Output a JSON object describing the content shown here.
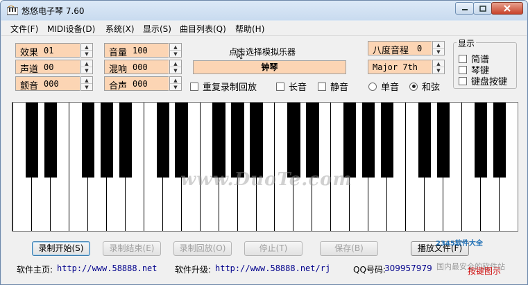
{
  "window": {
    "title": "悠悠电子琴 7.60"
  },
  "menu": [
    "文件(F)",
    "MIDI设备(D)",
    "系统(X)",
    "显示(S)",
    "曲目列表(Q)",
    "帮助(H)"
  ],
  "controls": {
    "effect": {
      "label": "效果",
      "value": "01"
    },
    "channel": {
      "label": "声道",
      "value": "00"
    },
    "tremolo": {
      "label": "颤音",
      "value": "000"
    },
    "volume": {
      "label": "音量",
      "value": "100"
    },
    "reverb": {
      "label": "混响",
      "value": "000"
    },
    "chorus": {
      "label": "合声",
      "value": "000"
    },
    "octave": {
      "label": "八度音程",
      "value": "0"
    },
    "chord_type": {
      "value": "Major 7th"
    }
  },
  "instrument": {
    "caption": "点击选择模拟乐器",
    "name": "钟琴"
  },
  "options": {
    "repeat_playback": {
      "label": "重复录制回放",
      "checked": false
    },
    "sustain": {
      "label": "长音",
      "checked": false
    },
    "mute": {
      "label": "静音",
      "checked": false
    },
    "single_note": {
      "label": "单音",
      "selected": false
    },
    "chord": {
      "label": "和弦",
      "selected": true
    }
  },
  "display_group": {
    "title": "显示",
    "items": [
      {
        "label": "简谱",
        "checked": false
      },
      {
        "label": "琴键",
        "checked": false
      },
      {
        "label": "键盘按键",
        "checked": false
      }
    ]
  },
  "piano": {
    "white_keys": 27,
    "black_key_pattern": [
      1,
      1,
      0,
      1,
      1,
      1,
      0,
      1,
      1,
      0,
      1,
      1,
      1,
      0,
      1,
      1,
      0,
      1,
      1,
      1,
      0,
      1,
      1,
      0,
      1,
      1
    ]
  },
  "watermark": "www.DuoTe.com",
  "buttons": [
    {
      "label": "录制开始(S)",
      "enabled": true
    },
    {
      "label": "录制结束(E)",
      "enabled": false
    },
    {
      "label": "录制回放(O)",
      "enabled": false
    },
    {
      "label": "停止(T)",
      "enabled": false
    },
    {
      "label": "保存(B)",
      "enabled": false
    },
    {
      "label": "播放文件(F)",
      "enabled": true
    }
  ],
  "footer": {
    "homepage_label": "软件主页:",
    "homepage_url": "http://www.58888.net",
    "upgrade_label": "软件升级:",
    "upgrade_url": "http://www.58888.net/rj",
    "qq_label": "QQ号码:",
    "qq_value": "309957979"
  },
  "corner": {
    "logo": "2345软件大全",
    "sub": "国内最安全的软件站",
    "red": "按键图示"
  },
  "colors": {
    "field_bg": "#fcd5b4",
    "link_blue": "#00008b",
    "accent_red": "#d01010"
  }
}
